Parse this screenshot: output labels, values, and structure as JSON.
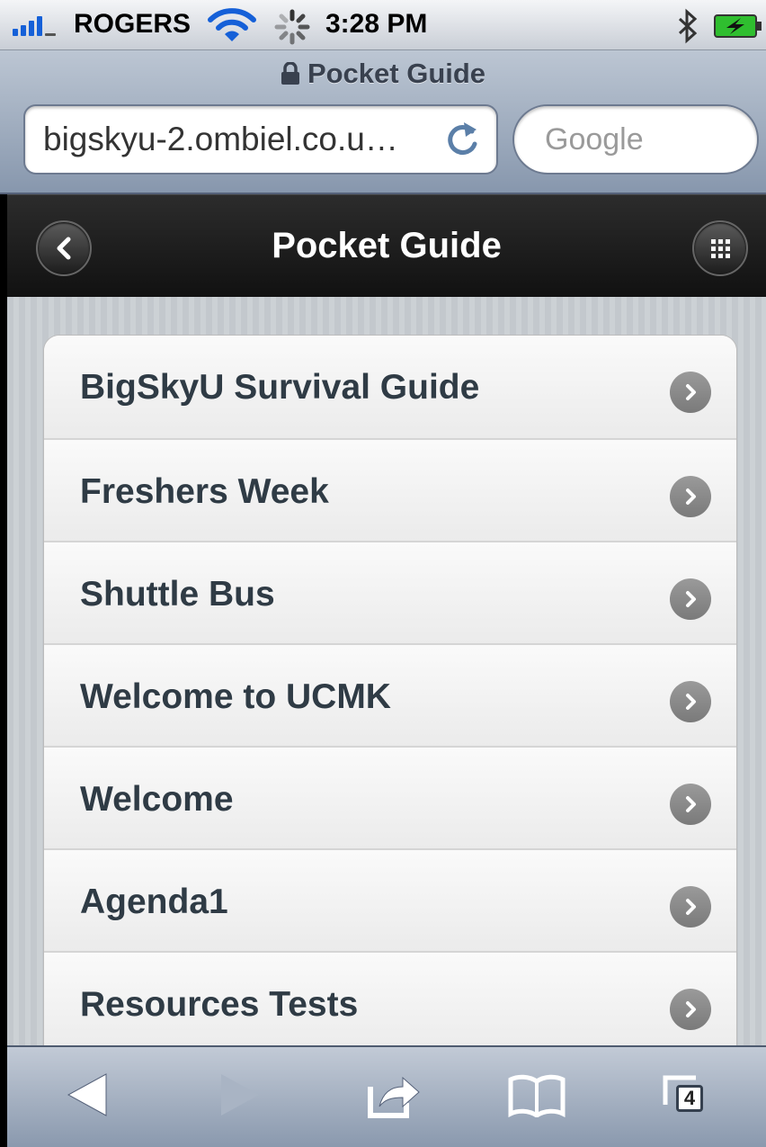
{
  "status_bar": {
    "carrier": "ROGERS",
    "time": "3:28 PM"
  },
  "browser": {
    "page_title": "Pocket Guide",
    "url": "bigskyu-2.ombiel.co.u…",
    "search_placeholder": "Google",
    "open_tabs": "4"
  },
  "app": {
    "title": "Pocket Guide",
    "menu_items": [
      {
        "label": "BigSkyU Survival Guide"
      },
      {
        "label": "Freshers Week"
      },
      {
        "label": "Shuttle Bus"
      },
      {
        "label": "Welcome to UCMK"
      },
      {
        "label": "Welcome"
      },
      {
        "label": "Agenda1"
      },
      {
        "label": "Resources Tests"
      }
    ]
  },
  "icons": {
    "signal": "signal-bars-icon",
    "wifi": "wifi-icon",
    "activity": "activity-spinner-icon",
    "bluetooth": "bluetooth-icon",
    "battery": "battery-charging-icon",
    "lock": "lock-icon",
    "reload": "reload-icon",
    "back": "back-arrow-icon",
    "forward": "forward-arrow-icon",
    "share": "share-icon",
    "bookmarks": "bookmarks-icon",
    "tabs": "tabs-icon",
    "chevron": "chevron-right-icon",
    "grid": "grid-menu-icon"
  },
  "colors": {
    "accent": "#1560d8",
    "header_bg": "#1a1a1a",
    "list_text": "#2f3b45"
  }
}
